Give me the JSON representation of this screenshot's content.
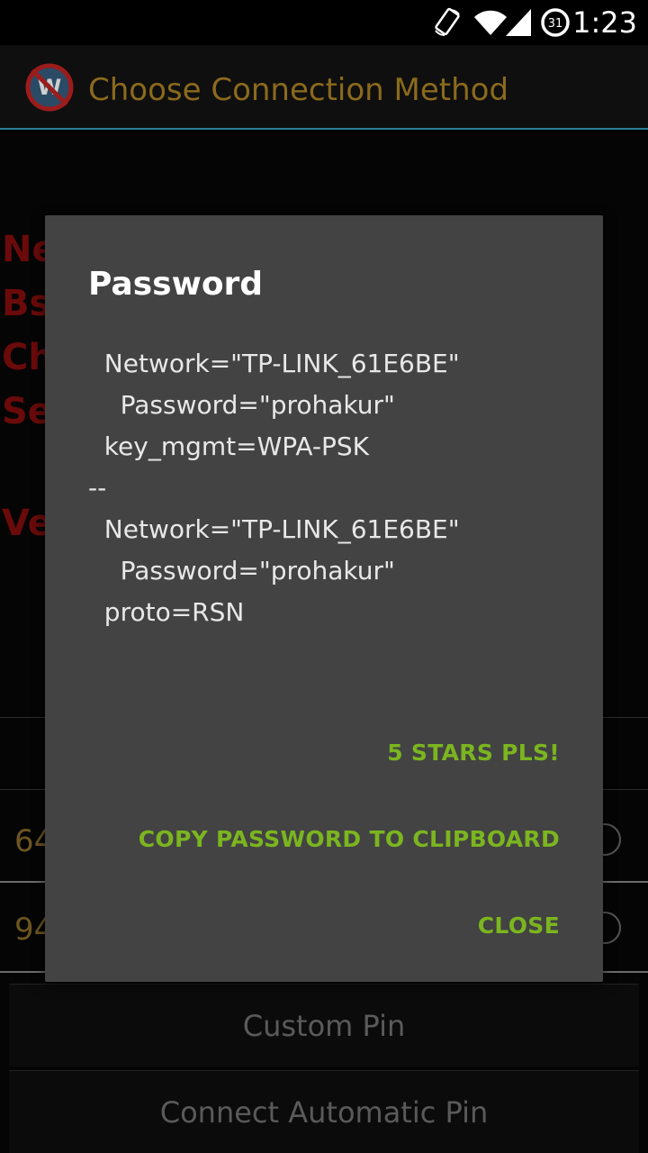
{
  "status_bar": {
    "time": "1:23",
    "icons": [
      "screen-rotation-icon",
      "wifi-icon",
      "signal-icon",
      "battery-icon"
    ],
    "battery_level": "31"
  },
  "action_bar": {
    "title": "Choose Connection Method",
    "title_color": "#8b6a1c"
  },
  "background": {
    "labels": [
      "Ne",
      "Bs",
      "Ch",
      "Se",
      "Ve"
    ],
    "pins": [
      "64",
      "94"
    ],
    "buttons": {
      "custom_pin": "Custom Pin",
      "connect_automatic_pin": "Connect Automatic Pin"
    }
  },
  "dialog": {
    "title": "Password",
    "lines": [
      "  Network=\"TP-LINK_61E6BE\"",
      "    Password=\"prohakur\"",
      "  key_mgmt=WPA-PSK",
      "--",
      "  Network=\"TP-LINK_61E6BE\"",
      "    Password=\"prohakur\"",
      "  proto=RSN"
    ],
    "actions": {
      "rate": "5 STARS PLS!",
      "copy": "COPY PASSWORD TO CLIPBOARD",
      "close": "CLOSE"
    },
    "accent_color": "#7bb51f"
  }
}
